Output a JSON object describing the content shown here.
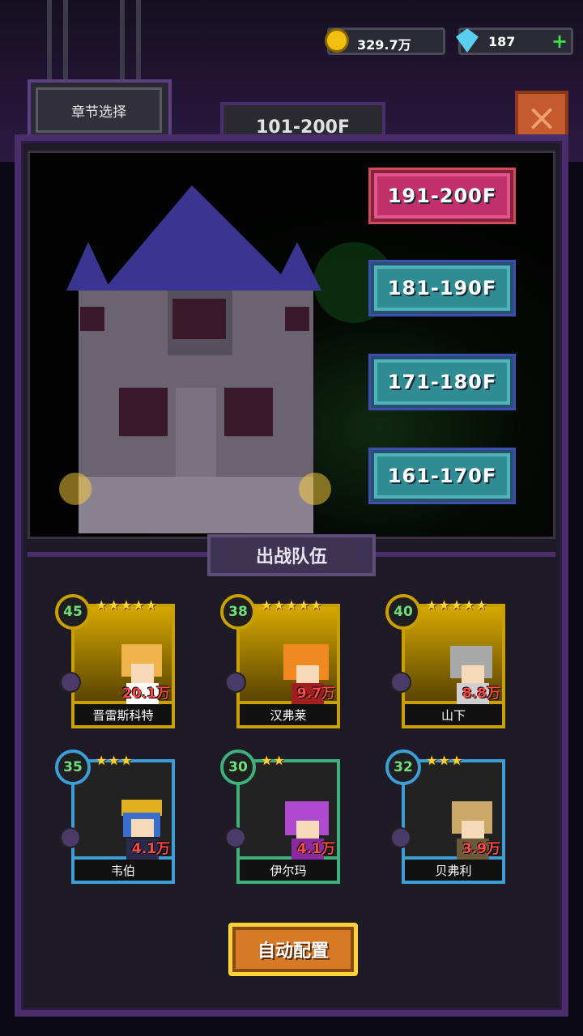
{
  "currency": {
    "gold": "329.7万",
    "gems": "187",
    "gems_add": "+"
  },
  "header": {
    "chapter_select": "章节选择",
    "floor_range": "101-200F",
    "close": "×"
  },
  "stages": [
    {
      "label": "191-200F",
      "selected": true
    },
    {
      "label": "181-190F",
      "selected": false
    },
    {
      "label": "171-180F",
      "selected": false
    },
    {
      "label": "161-170F",
      "selected": false
    }
  ],
  "team": {
    "title": "出战队伍",
    "heroes": [
      {
        "level": "45",
        "stars": "★★★★★",
        "power": "20.1万",
        "name": "晋雷斯科特",
        "frame": "gold",
        "hair": "#f0b24a"
      },
      {
        "level": "38",
        "stars": "★★★★★",
        "power": "9.7万",
        "name": "汉弗莱",
        "frame": "gold",
        "hair": "#f08a20"
      },
      {
        "level": "40",
        "stars": "★★★★★",
        "power": "8.8万",
        "name": "山下",
        "frame": "gold",
        "hair": "#a9a9a9"
      },
      {
        "level": "35",
        "stars": "★★★",
        "power": "4.1万",
        "name": "韦伯",
        "frame": "blue",
        "hair": "#3a6fd0"
      },
      {
        "level": "30",
        "stars": "★★",
        "power": "4.1万",
        "name": "伊尔玛",
        "frame": "green",
        "hair": "#b04ad0"
      },
      {
        "level": "32",
        "stars": "★★★",
        "power": "3.9万",
        "name": "贝弗利",
        "frame": "blue",
        "hair": "#c9a86a"
      }
    ]
  },
  "auto_button": "自动配置"
}
